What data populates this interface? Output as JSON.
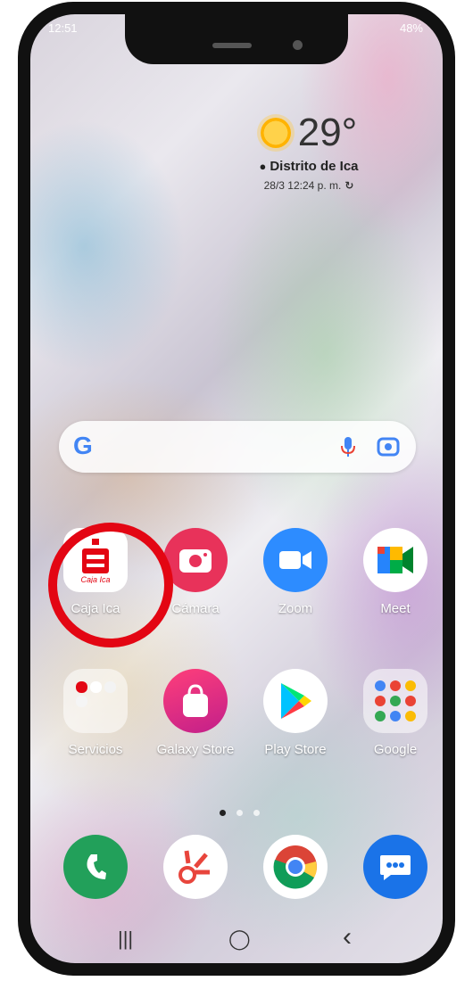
{
  "status": {
    "time": "12:51",
    "battery": "48%"
  },
  "weather": {
    "temperature": "29°",
    "location": "Distrito de Ica",
    "updated": "28/3 12:24 p. m."
  },
  "search": {
    "logo": "G"
  },
  "apps_row1": [
    {
      "label": "Caja Ica",
      "icon": "caja-ica-icon",
      "icon_text": "Caja Ica"
    },
    {
      "label": "Cámara",
      "icon": "camera-icon"
    },
    {
      "label": "Zoom",
      "icon": "zoom-icon"
    },
    {
      "label": "Meet",
      "icon": "meet-icon"
    }
  ],
  "apps_row2": [
    {
      "label": "Servicios",
      "icon": "folder-icon"
    },
    {
      "label": "Galaxy Store",
      "icon": "galaxy-store-icon"
    },
    {
      "label": "Play Store",
      "icon": "play-store-icon"
    },
    {
      "label": "Google",
      "icon": "google-folder-icon"
    }
  ],
  "dock": [
    {
      "name": "phone",
      "icon": "phone-icon"
    },
    {
      "name": "app",
      "icon": "app-icon"
    },
    {
      "name": "chrome",
      "icon": "chrome-icon"
    },
    {
      "name": "messages",
      "icon": "messages-icon"
    }
  ],
  "highlight": {
    "color": "#e30613"
  },
  "nav": {
    "recent": "|||",
    "home": "◯",
    "back": "‹"
  }
}
